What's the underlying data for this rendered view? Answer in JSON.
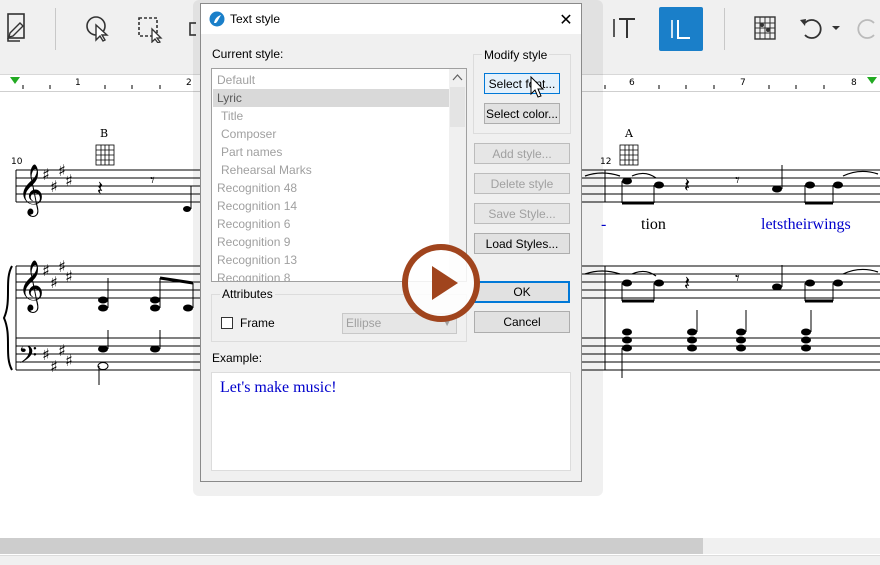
{
  "ruler": {
    "numbers": [
      "1",
      "2",
      "6",
      "7",
      "8"
    ]
  },
  "score": {
    "chords": [
      "B",
      "A"
    ],
    "measures": [
      "10",
      "12"
    ],
    "lyrics": [
      "-",
      "tion",
      "letstheirwings"
    ]
  },
  "dialog": {
    "title": "Text style",
    "close_glyph": "✕",
    "current_style_label": "Current style:",
    "styles": [
      "Default",
      "Lyric",
      "Title",
      "Composer",
      "Part names",
      "Rehearsal Marks",
      "Recognition 48",
      "Recognition 14",
      "Recognition 6",
      "Recognition 9",
      "Recognition 13",
      "Recognition 8"
    ],
    "selected_style": "Lyric",
    "modify_style_label": "Modify style",
    "select_font": "Select font...",
    "select_color": "Select color...",
    "add_style": "Add style...",
    "delete_style": "Delete style",
    "save_style": "Save Style...",
    "load_styles": "Load Styles...",
    "ok": "OK",
    "cancel": "Cancel",
    "attributes_label": "Attributes",
    "frame_label": "Frame",
    "frame_shape": "Ellipse",
    "example_label": "Example:",
    "example_text": "Let's make music!"
  },
  "colors": {
    "accent": "#0078d7",
    "lyric": "#0000cc",
    "play": "#a0441d",
    "toolbar_active": "#1a7fc9"
  },
  "icons": [
    "document-pencil-icon",
    "select-arrow-icon",
    "select-rect-icon",
    "text-tool-icon",
    "lyric-tool-icon",
    "chord-grid-icon",
    "undo-icon",
    "redo-icon",
    "play-icon",
    "cursor-icon",
    "dialog-app-icon"
  ]
}
